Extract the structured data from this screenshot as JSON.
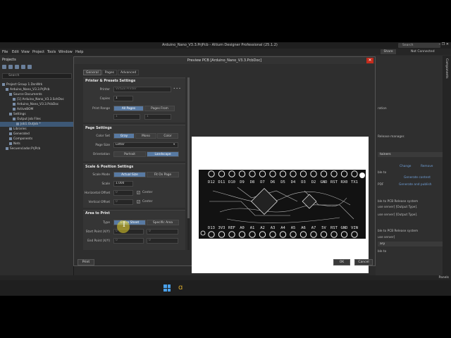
{
  "window": {
    "title": "Arduino_Nano_V3.3.PrjPcb - Altium Designer Professional (25.1.2)",
    "search_placeholder": "Search",
    "controls": "–  ❐  ✕"
  },
  "menu": {
    "items": [
      "File",
      "Edit",
      "View",
      "Project",
      "Tools",
      "Window",
      "Help"
    ],
    "share_label": "Share",
    "connection_status": "Not Connected"
  },
  "left_panel": {
    "title": "Projects",
    "search_placeholder": "Search",
    "tree": [
      {
        "label": "Project Group 1.DsnWrk",
        "indent": 0
      },
      {
        "label": "Arduino_Nano_V3.3.PrjPcb",
        "indent": 1
      },
      {
        "label": "Source Documents",
        "indent": 2
      },
      {
        "label": "[1] Arduino_Nano_V3.3.SchDoc",
        "indent": 3
      },
      {
        "label": "Arduino_Nano_V3.3.PcbDoc",
        "indent": 3
      },
      {
        "label": "ActiveBOM",
        "indent": 3
      },
      {
        "label": "Settings",
        "indent": 2
      },
      {
        "label": "Output Job Files",
        "indent": 3
      },
      {
        "label": "Job1.OutJob *",
        "indent": 4,
        "selected": true
      },
      {
        "label": "Libraries",
        "indent": 2
      },
      {
        "label": "Generated",
        "indent": 2
      },
      {
        "label": "Components",
        "indent": 2
      },
      {
        "label": "Nets",
        "indent": 2
      },
      {
        "label": "Secuenciador.PrjPcb",
        "indent": 1
      }
    ],
    "bottom_tabs": [
      "Projects",
      "Navigator"
    ]
  },
  "right_panel": {
    "texts": [
      "ration",
      "Release manager.",
      "tainers",
      "Change",
      "Remove",
      "ble to",
      "Generate content",
      "PDF",
      "Generate and publish",
      "ble to PCB Release system",
      "use server] [Output Type].",
      "use server] [Output Type].",
      "ble to PCB Release system",
      "use server]",
      "ary",
      "ble to"
    ],
    "components_tab": "Components"
  },
  "status": {
    "panels_label": "Panels"
  },
  "dialog": {
    "title": "Preview PCB [Arduino_Nano_V3.3.PcbDoc]",
    "tabs": [
      "General",
      "Pages",
      "Advanced"
    ],
    "printer_section": {
      "title": "Printer & Presets Settings",
      "printer_label": "Printer",
      "printer_value": "Virtual Printer",
      "copies_label": "Copies",
      "copies_value": "1",
      "print_range_label": "Print Range",
      "range_options": [
        "All Pages",
        "Pages From"
      ],
      "from_value": "1",
      "to_value": "1"
    },
    "page_section": {
      "title": "Page Settings",
      "color_label": "Color Set",
      "color_options": [
        "Gray",
        "Mono",
        "Color"
      ],
      "size_label": "Page Size",
      "size_value": "Letter",
      "orientation_label": "Orientation",
      "orientation_options": [
        "Portrait",
        "Landscape"
      ]
    },
    "scale_section": {
      "title": "Scale & Position Settings",
      "mode_label": "Scale Mode",
      "mode_options": [
        "Actual Size",
        "Fit On Page"
      ],
      "scale_label": "Scale",
      "scale_value": "1.000",
      "h_offset_label": "Horizontal Offset",
      "h_offset_value": "0",
      "v_offset_label": "Vertical Offset",
      "v_offset_value": "0",
      "center_label": "Center"
    },
    "area_section": {
      "title": "Area to Print",
      "type_label": "Type",
      "type_options": [
        "Entire Sheet",
        "Specific Area"
      ],
      "start_label": "Start Point (X/Y)",
      "end_label": "End Point (X/Y)",
      "start_x": "0",
      "start_y": "0",
      "end_x": "0",
      "end_y": "0"
    },
    "pager_text": "Page 1 of 1",
    "buttons": {
      "print": "Print",
      "ok": "OK",
      "cancel": "Cancel"
    }
  },
  "pcb": {
    "top_labels": [
      "D13",
      "3V3",
      "REF",
      "A0",
      "A1",
      "A2",
      "A3",
      "A4",
      "A5",
      "A6",
      "A7",
      "5V",
      "RST",
      "GND",
      "VIN"
    ],
    "bottom_labels": [
      "D12",
      "D11",
      "D10",
      "D9",
      "D8",
      "D7",
      "D6",
      "D5",
      "D4",
      "D3",
      "D2",
      "GND",
      "RST",
      "RX0",
      "TX1"
    ]
  },
  "colors": {
    "accent": "#587aa3",
    "selection": "#3d5876",
    "close": "#c42b1c",
    "cursor": "#e6d228"
  }
}
